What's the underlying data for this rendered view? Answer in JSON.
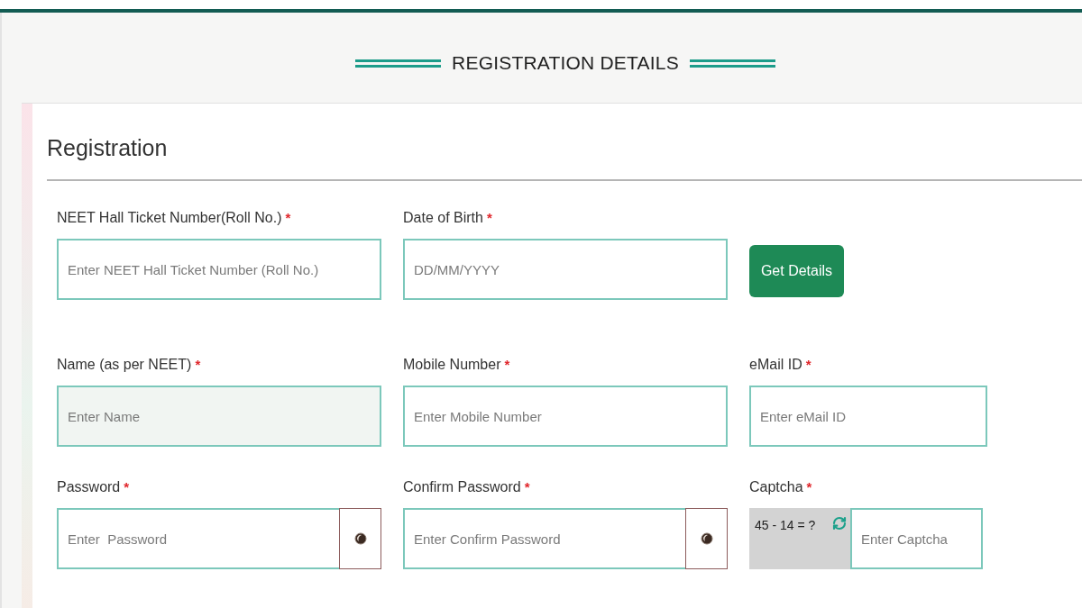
{
  "page": {
    "heading": "REGISTRATION DETAILS"
  },
  "form": {
    "title": "Registration",
    "rows": [
      [
        {
          "kind": "text",
          "label": "NEET Hall Ticket Number(Roll No.)",
          "required_mark": "*",
          "placeholder": "Enter NEET Hall Ticket Number (Roll No.)",
          "readonly": false
        },
        {
          "kind": "text",
          "label": "Date of Birth",
          "required_mark": "*",
          "placeholder": "DD/MM/YYYY",
          "readonly": false
        },
        {
          "kind": "button",
          "label": "Get Details"
        }
      ],
      [
        {
          "kind": "text",
          "label": "Name (as per NEET)",
          "required_mark": "*",
          "placeholder": "Enter Name",
          "readonly": true
        },
        {
          "kind": "text",
          "label": "Mobile Number",
          "required_mark": "*",
          "placeholder": "Enter Mobile Number",
          "readonly": false
        },
        {
          "kind": "text",
          "label": "eMail ID",
          "required_mark": "*",
          "placeholder": "Enter eMail ID",
          "readonly": false
        }
      ],
      [
        {
          "kind": "password",
          "label": "Password",
          "required_mark": "*",
          "placeholder": "Enter  Password",
          "readonly": false
        },
        {
          "kind": "password",
          "label": "Confirm Password",
          "required_mark": "*",
          "placeholder": "Enter Confirm Password",
          "readonly": false
        },
        {
          "kind": "captcha",
          "label": "Captcha",
          "required_mark": "*",
          "challenge": "45 - 14 = ?",
          "placeholder": "Enter Captcha",
          "readonly": false
        }
      ]
    ]
  }
}
